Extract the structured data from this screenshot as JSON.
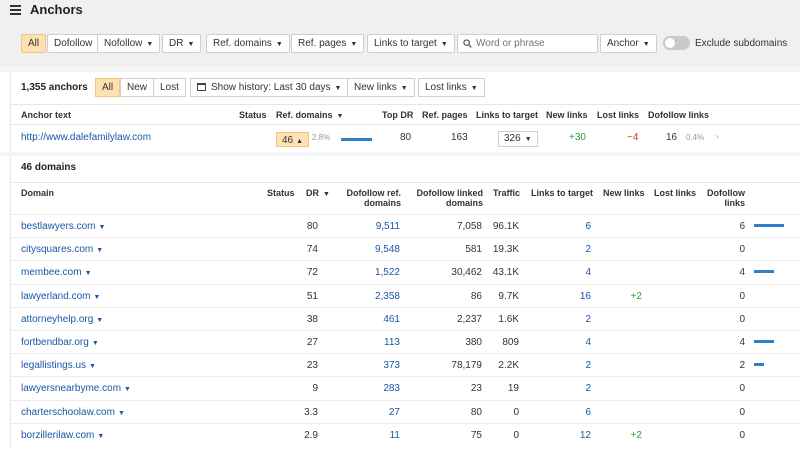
{
  "page": {
    "title": "Anchors"
  },
  "filters": {
    "all": "All",
    "dofollow": "Dofollow",
    "nofollow": "Nofollow",
    "dr": "DR",
    "ref_domains": "Ref. domains",
    "ref_pages": "Ref. pages",
    "links_to_target": "Links to target",
    "search_placeholder": "Word or phrase",
    "anchor": "Anchor",
    "exclude_subdomains": "Exclude subdomains"
  },
  "summary": {
    "count": "1,355 anchors",
    "seg_all": "All",
    "seg_new": "New",
    "seg_lost": "Lost",
    "history": "Show history: Last 30 days",
    "new_links": "New links",
    "lost_links": "Lost links"
  },
  "anchor_table": {
    "headers": {
      "anchor_text": "Anchor text",
      "status": "Status",
      "ref_domains": "Ref. domains",
      "top_dr": "Top DR",
      "ref_pages": "Ref. pages",
      "links_to_target": "Links to target",
      "new_links": "New links",
      "lost_links": "Lost links",
      "dofollow_links": "Dofollow links"
    },
    "row": {
      "anchor": "http://www.dalefamilylaw.com",
      "ref_domains": "46",
      "ref_domains_pct": "2.8%",
      "ref_domains_share": 0.028,
      "top_dr": "80",
      "ref_pages": "163",
      "links_to_target": "326",
      "new_links": "+30",
      "lost_links": "−4",
      "dofollow_links": "16",
      "dofollow_pct": "0.4%"
    }
  },
  "domains": {
    "title": "46 domains",
    "headers": {
      "domain": "Domain",
      "status": "Status",
      "dr": "DR",
      "dofollow_ref_1": "Dofollow ref.",
      "dofollow_ref_2": "domains",
      "dofollow_linked_1": "Dofollow linked",
      "dofollow_linked_2": "domains",
      "traffic": "Traffic",
      "links_to_target": "Links to target",
      "new_links": "New links",
      "lost_links": "Lost links",
      "dofollow_links_1": "Dofollow",
      "dofollow_links_2": "links"
    },
    "rows": [
      {
        "domain": "bestlawyers.com",
        "dr": "80",
        "dofollow_ref": "9,511",
        "dofollow_linked": "7,058",
        "traffic": "96.1K",
        "links_to_target": "6",
        "new_links": "",
        "lost_links": "",
        "dofollow_links": "6",
        "dofollow_share": 0.375
      },
      {
        "domain": "citysquares.com",
        "dr": "74",
        "dofollow_ref": "9,548",
        "dofollow_linked": "581",
        "traffic": "19.3K",
        "links_to_target": "2",
        "new_links": "",
        "lost_links": "",
        "dofollow_links": "0",
        "dofollow_share": 0
      },
      {
        "domain": "membee.com",
        "dr": "72",
        "dofollow_ref": "1,522",
        "dofollow_linked": "30,462",
        "traffic": "43.1K",
        "links_to_target": "4",
        "new_links": "",
        "lost_links": "",
        "dofollow_links": "4",
        "dofollow_share": 0.25
      },
      {
        "domain": "lawyerland.com",
        "dr": "51",
        "dofollow_ref": "2,358",
        "dofollow_linked": "86",
        "traffic": "9.7K",
        "links_to_target": "16",
        "new_links": "+2",
        "lost_links": "",
        "dofollow_links": "0",
        "dofollow_share": 0
      },
      {
        "domain": "attorneyhelp.org",
        "dr": "38",
        "dofollow_ref": "461",
        "dofollow_linked": "2,237",
        "traffic": "1.6K",
        "links_to_target": "2",
        "new_links": "",
        "lost_links": "",
        "dofollow_links": "0",
        "dofollow_share": 0
      },
      {
        "domain": "fortbendbar.org",
        "dr": "27",
        "dofollow_ref": "113",
        "dofollow_linked": "380",
        "traffic": "809",
        "links_to_target": "4",
        "new_links": "",
        "lost_links": "",
        "dofollow_links": "4",
        "dofollow_share": 0.25
      },
      {
        "domain": "legallistings.us",
        "dr": "23",
        "dofollow_ref": "373",
        "dofollow_linked": "78,179",
        "traffic": "2.2K",
        "links_to_target": "2",
        "new_links": "",
        "lost_links": "",
        "dofollow_links": "2",
        "dofollow_share": 0.125
      },
      {
        "domain": "lawyersnearbyme.com",
        "dr": "9",
        "dofollow_ref": "283",
        "dofollow_linked": "23",
        "traffic": "19",
        "links_to_target": "2",
        "new_links": "",
        "lost_links": "",
        "dofollow_links": "0",
        "dofollow_share": 0
      },
      {
        "domain": "charterschoolaw.com",
        "dr": "3.3",
        "dofollow_ref": "27",
        "dofollow_linked": "80",
        "traffic": "0",
        "links_to_target": "6",
        "new_links": "",
        "lost_links": "",
        "dofollow_links": "0",
        "dofollow_share": 0
      },
      {
        "domain": "borzillerilaw.com",
        "dr": "2.9",
        "dofollow_ref": "11",
        "dofollow_linked": "75",
        "traffic": "0",
        "links_to_target": "12",
        "new_links": "+2",
        "lost_links": "",
        "dofollow_links": "0",
        "dofollow_share": 0
      }
    ]
  },
  "colors": {
    "accent": "#fde1b3",
    "link": "#1a57a6",
    "bar": "#2f80c8",
    "green": "#2e9e3e",
    "red": "#d9322b"
  }
}
